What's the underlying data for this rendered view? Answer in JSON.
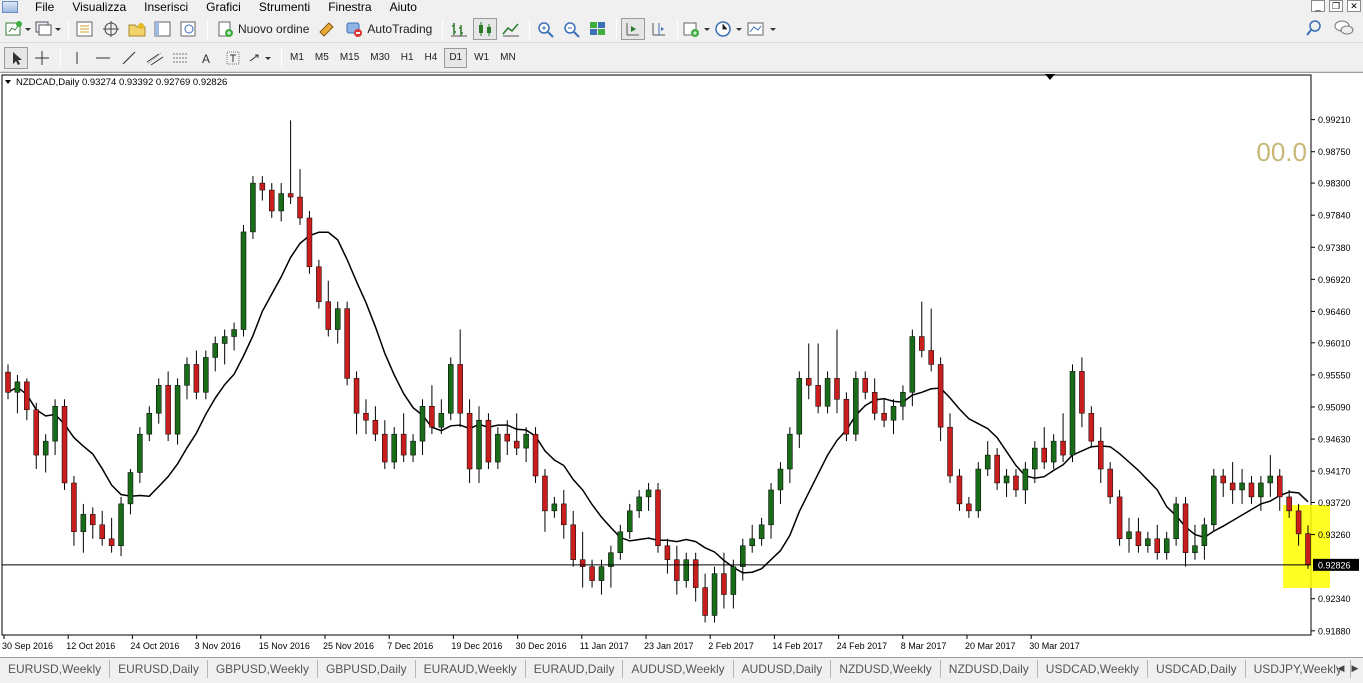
{
  "menu": [
    "File",
    "Visualizza",
    "Inserisci",
    "Grafici",
    "Strumenti",
    "Finestra",
    "Aiuto"
  ],
  "toolbar": {
    "new_order": "Nuovo ordine",
    "autotrading": "AutoTrading",
    "timeframes": [
      "M1",
      "M5",
      "M15",
      "M30",
      "H1",
      "H4",
      "D1",
      "W1",
      "MN"
    ],
    "active_timeframe": "D1"
  },
  "chart": {
    "header": "NZDCAD,Daily  0.93274 0.93392 0.92769 0.92826",
    "overlay_value": "00.0",
    "current_price_label": "0.92826",
    "colors": {
      "bull": "#1a6b1a",
      "bear": "#c81e1e",
      "ma": "#000000",
      "highlight": "#ffff00",
      "overlay_text": "#c8b878"
    }
  },
  "chart_data": {
    "type": "candlestick",
    "symbol": "NZDCAD",
    "timeframe": "Daily",
    "last": {
      "open": 0.93274,
      "high": 0.93392,
      "low": 0.92769,
      "close": 0.92826
    },
    "y_ticks": [
      "0.99210",
      "0.98750",
      "0.98300",
      "0.97840",
      "0.97380",
      "0.96920",
      "0.96460",
      "0.96010",
      "0.95550",
      "0.95090",
      "0.94630",
      "0.94170",
      "0.93720",
      "0.93260",
      "0.92340",
      "0.91880"
    ],
    "ylim": [
      0.9182,
      0.9985
    ],
    "x_ticks": [
      "30 Sep 2016",
      "12 Oct 2016",
      "24 Oct 2016",
      "3 Nov 2016",
      "15 Nov 2016",
      "25 Nov 2016",
      "7 Dec 2016",
      "19 Dec 2016",
      "30 Dec 2016",
      "11 Jan 2017",
      "23 Jan 2017",
      "2 Feb 2017",
      "14 Feb 2017",
      "24 Feb 2017",
      "8 Mar 2017",
      "20 Mar 2017",
      "30 Mar 2017"
    ],
    "candles": [
      [
        0.9559,
        0.957,
        0.952,
        0.953
      ],
      [
        0.953,
        0.9555,
        0.95,
        0.9545
      ],
      [
        0.9545,
        0.955,
        0.949,
        0.9505
      ],
      [
        0.9505,
        0.9515,
        0.942,
        0.944
      ],
      [
        0.944,
        0.947,
        0.9415,
        0.946
      ],
      [
        0.946,
        0.952,
        0.944,
        0.951
      ],
      [
        0.951,
        0.952,
        0.939,
        0.94
      ],
      [
        0.94,
        0.941,
        0.931,
        0.933
      ],
      [
        0.933,
        0.937,
        0.93,
        0.9355
      ],
      [
        0.9355,
        0.9365,
        0.932,
        0.934
      ],
      [
        0.934,
        0.936,
        0.931,
        0.932
      ],
      [
        0.932,
        0.935,
        0.93,
        0.931
      ],
      [
        0.931,
        0.938,
        0.9295,
        0.937
      ],
      [
        0.937,
        0.942,
        0.9355,
        0.9415
      ],
      [
        0.9415,
        0.948,
        0.94,
        0.947
      ],
      [
        0.947,
        0.951,
        0.946,
        0.95
      ],
      [
        0.95,
        0.955,
        0.9485,
        0.954
      ],
      [
        0.954,
        0.956,
        0.946,
        0.947
      ],
      [
        0.947,
        0.955,
        0.9455,
        0.954
      ],
      [
        0.954,
        0.958,
        0.952,
        0.957
      ],
      [
        0.957,
        0.959,
        0.952,
        0.953
      ],
      [
        0.953,
        0.959,
        0.952,
        0.958
      ],
      [
        0.958,
        0.961,
        0.956,
        0.96
      ],
      [
        0.96,
        0.962,
        0.957,
        0.961
      ],
      [
        0.961,
        0.963,
        0.959,
        0.962
      ],
      [
        0.962,
        0.977,
        0.961,
        0.976
      ],
      [
        0.976,
        0.984,
        0.975,
        0.983
      ],
      [
        0.983,
        0.984,
        0.9805,
        0.982
      ],
      [
        0.982,
        0.983,
        0.978,
        0.979
      ],
      [
        0.979,
        0.983,
        0.9775,
        0.9815
      ],
      [
        0.9815,
        0.992,
        0.98,
        0.981
      ],
      [
        0.981,
        0.985,
        0.977,
        0.978
      ],
      [
        0.978,
        0.979,
        0.97,
        0.971
      ],
      [
        0.971,
        0.972,
        0.965,
        0.966
      ],
      [
        0.966,
        0.969,
        0.961,
        0.962
      ],
      [
        0.962,
        0.966,
        0.96,
        0.965
      ],
      [
        0.965,
        0.966,
        0.954,
        0.955
      ],
      [
        0.955,
        0.956,
        0.947,
        0.95
      ],
      [
        0.95,
        0.952,
        0.947,
        0.949
      ],
      [
        0.949,
        0.951,
        0.946,
        0.947
      ],
      [
        0.947,
        0.949,
        0.942,
        0.943
      ],
      [
        0.943,
        0.948,
        0.942,
        0.947
      ],
      [
        0.947,
        0.95,
        0.943,
        0.944
      ],
      [
        0.944,
        0.947,
        0.943,
        0.946
      ],
      [
        0.946,
        0.952,
        0.944,
        0.951
      ],
      [
        0.951,
        0.954,
        0.947,
        0.948
      ],
      [
        0.948,
        0.952,
        0.947,
        0.95
      ],
      [
        0.95,
        0.958,
        0.949,
        0.957
      ],
      [
        0.957,
        0.962,
        0.948,
        0.95
      ],
      [
        0.95,
        0.952,
        0.94,
        0.942
      ],
      [
        0.942,
        0.951,
        0.94,
        0.949
      ],
      [
        0.949,
        0.95,
        0.942,
        0.943
      ],
      [
        0.943,
        0.948,
        0.942,
        0.947
      ],
      [
        0.947,
        0.949,
        0.944,
        0.946
      ],
      [
        0.946,
        0.95,
        0.944,
        0.945
      ],
      [
        0.945,
        0.948,
        0.943,
        0.947
      ],
      [
        0.947,
        0.948,
        0.94,
        0.941
      ],
      [
        0.941,
        0.942,
        0.933,
        0.936
      ],
      [
        0.936,
        0.938,
        0.935,
        0.937
      ],
      [
        0.937,
        0.939,
        0.932,
        0.934
      ],
      [
        0.934,
        0.936,
        0.928,
        0.929
      ],
      [
        0.929,
        0.933,
        0.925,
        0.928
      ],
      [
        0.928,
        0.929,
        0.925,
        0.926
      ],
      [
        0.926,
        0.929,
        0.924,
        0.928
      ],
      [
        0.928,
        0.931,
        0.925,
        0.93
      ],
      [
        0.93,
        0.934,
        0.929,
        0.933
      ],
      [
        0.933,
        0.937,
        0.932,
        0.936
      ],
      [
        0.936,
        0.939,
        0.935,
        0.938
      ],
      [
        0.938,
        0.94,
        0.936,
        0.939
      ],
      [
        0.939,
        0.94,
        0.93,
        0.931
      ],
      [
        0.931,
        0.932,
        0.927,
        0.929
      ],
      [
        0.929,
        0.931,
        0.924,
        0.926
      ],
      [
        0.926,
        0.93,
        0.925,
        0.929
      ],
      [
        0.929,
        0.93,
        0.923,
        0.925
      ],
      [
        0.925,
        0.927,
        0.92,
        0.921
      ],
      [
        0.921,
        0.928,
        0.92,
        0.927
      ],
      [
        0.927,
        0.93,
        0.922,
        0.924
      ],
      [
        0.924,
        0.929,
        0.922,
        0.928
      ],
      [
        0.928,
        0.932,
        0.926,
        0.931
      ],
      [
        0.931,
        0.934,
        0.93,
        0.932
      ],
      [
        0.932,
        0.935,
        0.931,
        0.934
      ],
      [
        0.934,
        0.94,
        0.932,
        0.939
      ],
      [
        0.939,
        0.943,
        0.937,
        0.942
      ],
      [
        0.942,
        0.948,
        0.94,
        0.947
      ],
      [
        0.947,
        0.956,
        0.945,
        0.955
      ],
      [
        0.955,
        0.96,
        0.952,
        0.954
      ],
      [
        0.954,
        0.96,
        0.95,
        0.951
      ],
      [
        0.951,
        0.956,
        0.95,
        0.955
      ],
      [
        0.955,
        0.962,
        0.95,
        0.952
      ],
      [
        0.952,
        0.953,
        0.946,
        0.947
      ],
      [
        0.947,
        0.956,
        0.946,
        0.955
      ],
      [
        0.955,
        0.956,
        0.952,
        0.953
      ],
      [
        0.953,
        0.955,
        0.949,
        0.95
      ],
      [
        0.95,
        0.952,
        0.948,
        0.949
      ],
      [
        0.949,
        0.952,
        0.947,
        0.951
      ],
      [
        0.951,
        0.954,
        0.949,
        0.953
      ],
      [
        0.953,
        0.962,
        0.951,
        0.961
      ],
      [
        0.961,
        0.966,
        0.958,
        0.959
      ],
      [
        0.959,
        0.965,
        0.956,
        0.957
      ],
      [
        0.957,
        0.958,
        0.946,
        0.948
      ],
      [
        0.948,
        0.95,
        0.94,
        0.941
      ],
      [
        0.941,
        0.942,
        0.936,
        0.937
      ],
      [
        0.937,
        0.938,
        0.935,
        0.936
      ],
      [
        0.936,
        0.943,
        0.935,
        0.942
      ],
      [
        0.942,
        0.946,
        0.941,
        0.944
      ],
      [
        0.944,
        0.945,
        0.939,
        0.94
      ],
      [
        0.94,
        0.942,
        0.938,
        0.941
      ],
      [
        0.941,
        0.942,
        0.938,
        0.939
      ],
      [
        0.939,
        0.943,
        0.937,
        0.942
      ],
      [
        0.942,
        0.946,
        0.94,
        0.945
      ],
      [
        0.945,
        0.948,
        0.942,
        0.943
      ],
      [
        0.943,
        0.947,
        0.942,
        0.946
      ],
      [
        0.946,
        0.95,
        0.943,
        0.944
      ],
      [
        0.944,
        0.957,
        0.943,
        0.956
      ],
      [
        0.956,
        0.958,
        0.948,
        0.95
      ],
      [
        0.95,
        0.951,
        0.945,
        0.946
      ],
      [
        0.946,
        0.948,
        0.94,
        0.942
      ],
      [
        0.942,
        0.943,
        0.937,
        0.938
      ],
      [
        0.938,
        0.939,
        0.931,
        0.932
      ],
      [
        0.932,
        0.935,
        0.93,
        0.933
      ],
      [
        0.933,
        0.935,
        0.93,
        0.931
      ],
      [
        0.931,
        0.933,
        0.93,
        0.932
      ],
      [
        0.932,
        0.934,
        0.929,
        0.93
      ],
      [
        0.93,
        0.933,
        0.929,
        0.932
      ],
      [
        0.932,
        0.938,
        0.931,
        0.937
      ],
      [
        0.937,
        0.938,
        0.928,
        0.93
      ],
      [
        0.93,
        0.934,
        0.929,
        0.931
      ],
      [
        0.931,
        0.935,
        0.929,
        0.934
      ],
      [
        0.934,
        0.942,
        0.933,
        0.941
      ],
      [
        0.941,
        0.942,
        0.938,
        0.94
      ],
      [
        0.94,
        0.943,
        0.937,
        0.939
      ],
      [
        0.939,
        0.942,
        0.937,
        0.94
      ],
      [
        0.94,
        0.941,
        0.937,
        0.938
      ],
      [
        0.938,
        0.941,
        0.936,
        0.94
      ],
      [
        0.94,
        0.944,
        0.938,
        0.941
      ],
      [
        0.941,
        0.942,
        0.936,
        0.938
      ],
      [
        0.938,
        0.939,
        0.935,
        0.936
      ],
      [
        0.936,
        0.937,
        0.931,
        0.9327
      ],
      [
        0.93274,
        0.93392,
        0.92769,
        0.92826
      ]
    ],
    "ma_period": 10,
    "highlight_last_candles": 3
  },
  "tabs": [
    "EURUSD,Weekly",
    "EURUSD,Daily",
    "GBPUSD,Weekly",
    "GBPUSD,Daily",
    "EURAUD,Weekly",
    "EURAUD,Daily",
    "AUDUSD,Weekly",
    "AUDUSD,Daily",
    "NZDUSD,Weekly",
    "NZDUSD,Daily",
    "USDCAD,Weekly",
    "USDCAD,Daily",
    "USDJPY,Weekly"
  ]
}
